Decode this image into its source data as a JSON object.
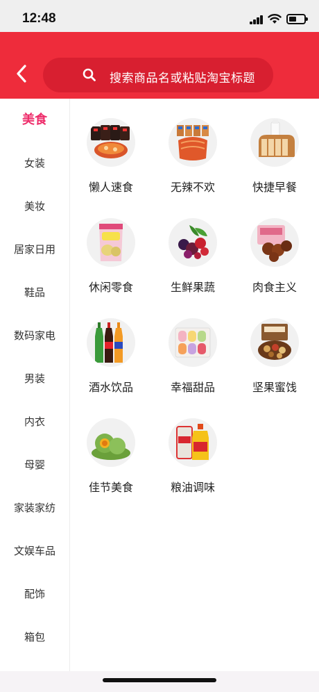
{
  "status_bar": {
    "time": "12:48"
  },
  "header": {
    "search_placeholder": "搜索商品名或粘贴淘宝标题",
    "accent_color": "#ee2c3b"
  },
  "sidebar": {
    "active_color": "#ee2c6a",
    "items": [
      {
        "label": "美食",
        "active": true
      },
      {
        "label": "女装"
      },
      {
        "label": "美妆"
      },
      {
        "label": "居家日用"
      },
      {
        "label": "鞋品"
      },
      {
        "label": "数码家电"
      },
      {
        "label": "男装"
      },
      {
        "label": "内衣"
      },
      {
        "label": "母婴"
      },
      {
        "label": "家装家纺"
      },
      {
        "label": "文娱车品"
      },
      {
        "label": "配饰"
      },
      {
        "label": "箱包"
      }
    ]
  },
  "categories": [
    {
      "label": "懒人速食",
      "icon": "instant-noodles-icon"
    },
    {
      "label": "无辣不欢",
      "icon": "spicy-snack-icon"
    },
    {
      "label": "快捷早餐",
      "icon": "bread-milk-icon"
    },
    {
      "label": "休闲零食",
      "icon": "chips-bag-icon"
    },
    {
      "label": "生鲜果蔬",
      "icon": "berries-icon"
    },
    {
      "label": "肉食主义",
      "icon": "meat-snack-icon"
    },
    {
      "label": "酒水饮品",
      "icon": "soda-bottles-icon"
    },
    {
      "label": "幸福甜品",
      "icon": "macarons-icon"
    },
    {
      "label": "坚果蜜饯",
      "icon": "nuts-box-icon"
    },
    {
      "label": "佳节美食",
      "icon": "green-dumplings-icon"
    },
    {
      "label": "粮油调味",
      "icon": "rice-oil-icon"
    }
  ]
}
